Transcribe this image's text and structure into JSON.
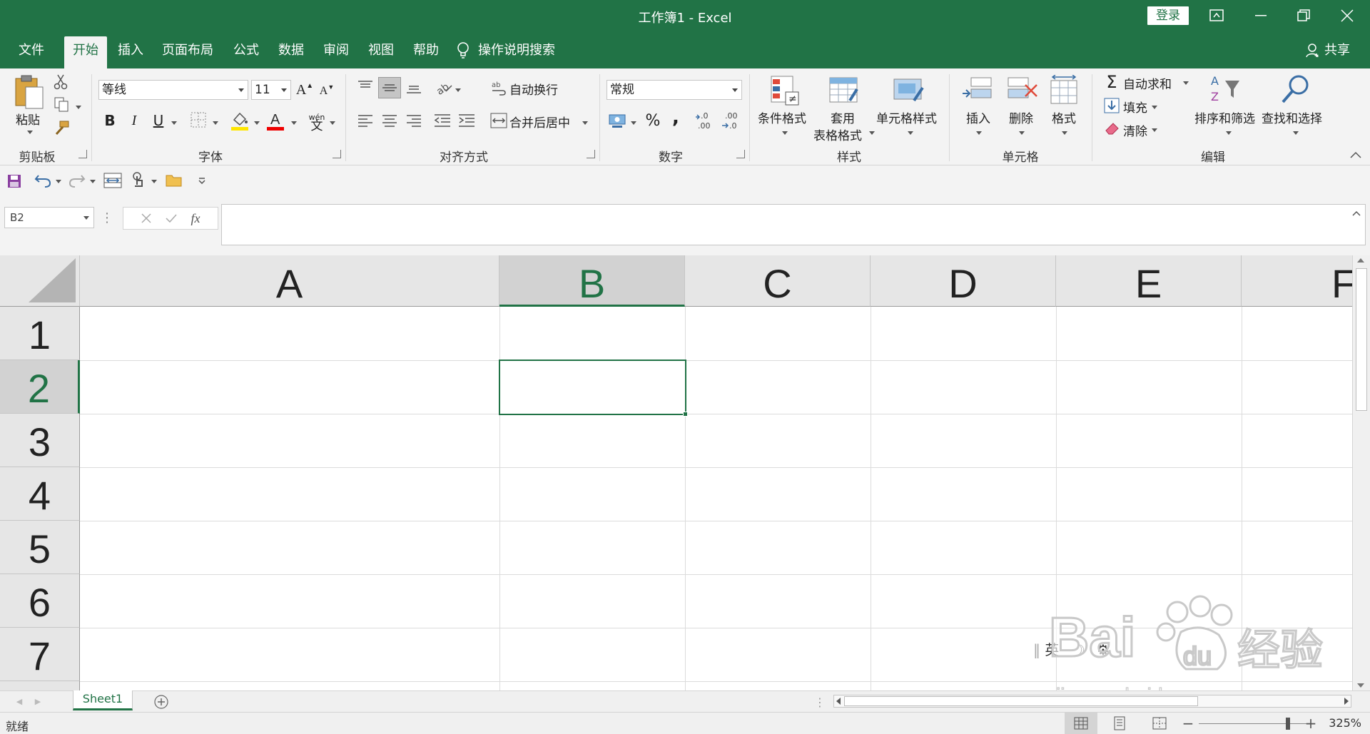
{
  "window": {
    "title": "工作簿1  -  Excel",
    "login_label": "登录"
  },
  "tabs": [
    "文件",
    "开始",
    "插入",
    "页面布局",
    "公式",
    "数据",
    "审阅",
    "视图",
    "帮助"
  ],
  "active_tab": "开始",
  "tell_me": "操作说明搜索",
  "share_label": "共享",
  "ribbon": {
    "clipboard": {
      "paste": "粘贴",
      "group": "剪贴板"
    },
    "font": {
      "name": "等线",
      "size": "11",
      "group": "字体",
      "phonetic": "wén"
    },
    "alignment": {
      "wrap": "自动换行",
      "merge": "合并后居中",
      "group": "对齐方式"
    },
    "number": {
      "format": "常规",
      "group": "数字",
      "percent": "%",
      "comma": ","
    },
    "styles": {
      "conditional": "条件格式",
      "table_line1": "套用",
      "table_line2": "表格格式",
      "cell_styles": "单元格样式",
      "group": "样式"
    },
    "cells": {
      "insert": "插入",
      "delete": "删除",
      "format": "格式",
      "group": "单元格"
    },
    "editing": {
      "autosum": "自动求和",
      "fill": "填充",
      "clear": "清除",
      "sort": "排序和筛选",
      "find": "查找和选择",
      "group": "编辑"
    }
  },
  "formula_bar": {
    "name_box": "B2",
    "fx": "fx",
    "formula": ""
  },
  "grid": {
    "columns": [
      "A",
      "B",
      "C",
      "D",
      "E",
      "F"
    ],
    "rows": [
      "1",
      "2",
      "3",
      "4",
      "5",
      "6",
      "7"
    ],
    "selected_column": "B",
    "selected_row": "2"
  },
  "sheets": [
    "Sheet1"
  ],
  "status": {
    "ready": "就绪",
    "zoom": "325%"
  },
  "overlay": {
    "ime_text": "英",
    "watermark_url": "jingyan.baidu.com"
  },
  "colors": {
    "brand": "#217346",
    "header_bg": "#e6e6e6",
    "grid_line": "#dcdcdc"
  }
}
